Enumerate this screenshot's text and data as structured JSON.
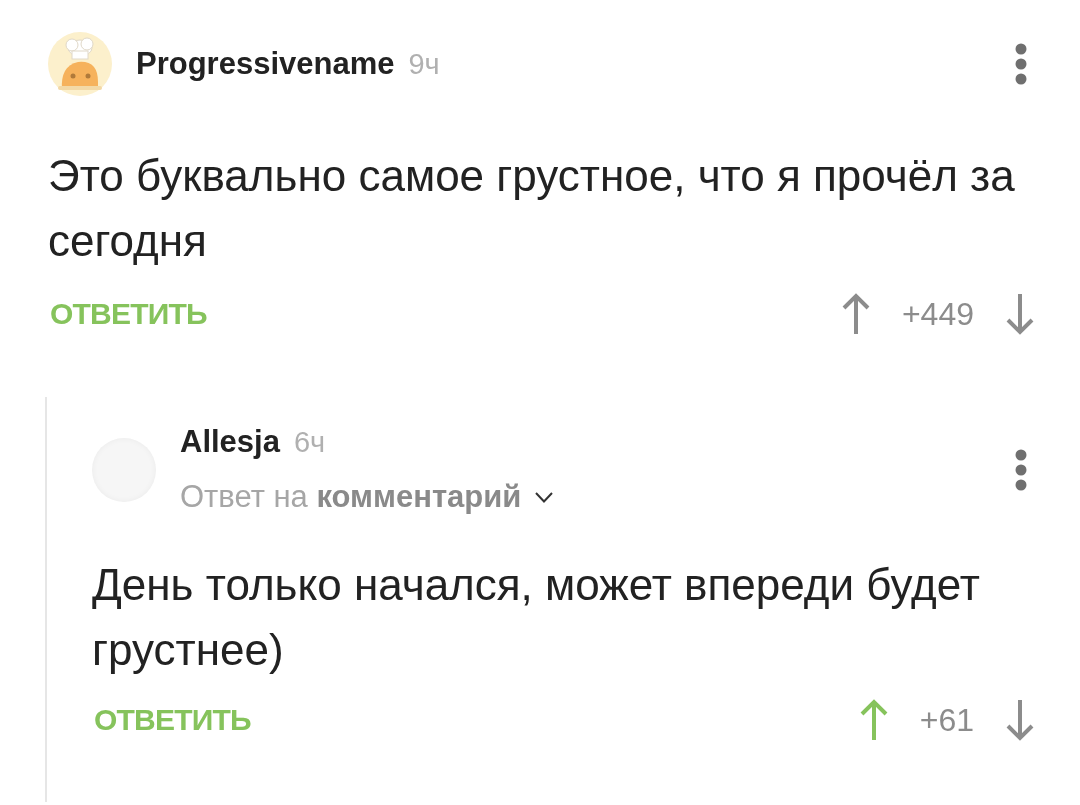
{
  "comments": [
    {
      "avatar": {
        "kind": "illustration"
      },
      "author": "Progressivename",
      "time": "9ч",
      "text": "Это буквально самое грустное, что я прочёл за сегодня",
      "reply_button": "ОТВЕТИТЬ",
      "rating": "+449",
      "upvoted": false,
      "downvoted": false,
      "children": [
        {
          "avatar": {
            "kind": "plain"
          },
          "author": "Allesja",
          "time": "6ч",
          "reply_to": "Ответ на **комментарий**",
          "text": "День только начался, может впереди будет грустнее)",
          "reply_button": "ОТВЕТИТЬ",
          "rating": "+61",
          "upvoted": true,
          "downvoted": false
        }
      ]
    }
  ]
}
